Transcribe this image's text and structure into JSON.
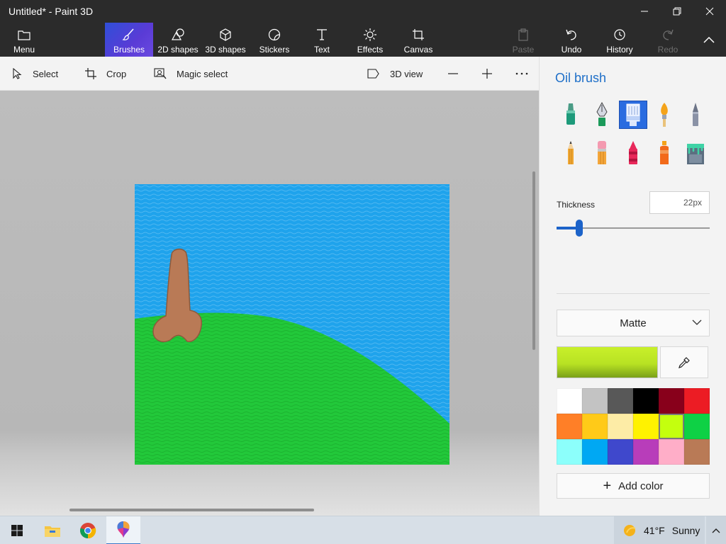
{
  "window": {
    "title": "Untitled* - Paint 3D"
  },
  "ribbon": {
    "menu": "Menu",
    "brushes": "Brushes",
    "shapes2d": "2D shapes",
    "shapes3d": "3D shapes",
    "stickers": "Stickers",
    "text": "Text",
    "effects": "Effects",
    "canvas": "Canvas",
    "paste": "Paste",
    "undo": "Undo",
    "history": "History",
    "redo": "Redo"
  },
  "toolbar": {
    "select": "Select",
    "crop": "Crop",
    "magic_select": "Magic select",
    "view3d": "3D view"
  },
  "panel": {
    "title": "Oil brush",
    "tools": [
      "Marker",
      "Calligraphy pen",
      "Oil brush",
      "Watercolor",
      "Pixel pen",
      "Pencil",
      "Eraser",
      "Crayon",
      "Spray can",
      "Fill"
    ],
    "selected_tool": "Oil brush",
    "thickness_label": "Thickness",
    "thickness_value": "22px",
    "thickness_level": 0.14,
    "finish": "Matte",
    "current_color": "#c8f02a",
    "palette": [
      "#ffffff",
      "#c3c3c3",
      "#585858",
      "#000000",
      "#88001b",
      "#ec1c24",
      "#ff7f27",
      "#ffca18",
      "#fdeca6",
      "#fff200",
      "#c4ff0e",
      "#0ed145",
      "#8cfffb",
      "#00a8f3",
      "#3f48cc",
      "#b83dba",
      "#ffaec8",
      "#b97a56"
    ],
    "selected_swatch": 10,
    "add_color": "Add color"
  },
  "taskbar": {
    "weather_temp": "41°F",
    "weather_condition": "Sunny"
  },
  "colors": {
    "accent": "#1e6fc8",
    "titlebar": "#2b2b2b",
    "sky": "#1fa3ec",
    "grass": "#22c83a",
    "figure": "#b97a56"
  }
}
